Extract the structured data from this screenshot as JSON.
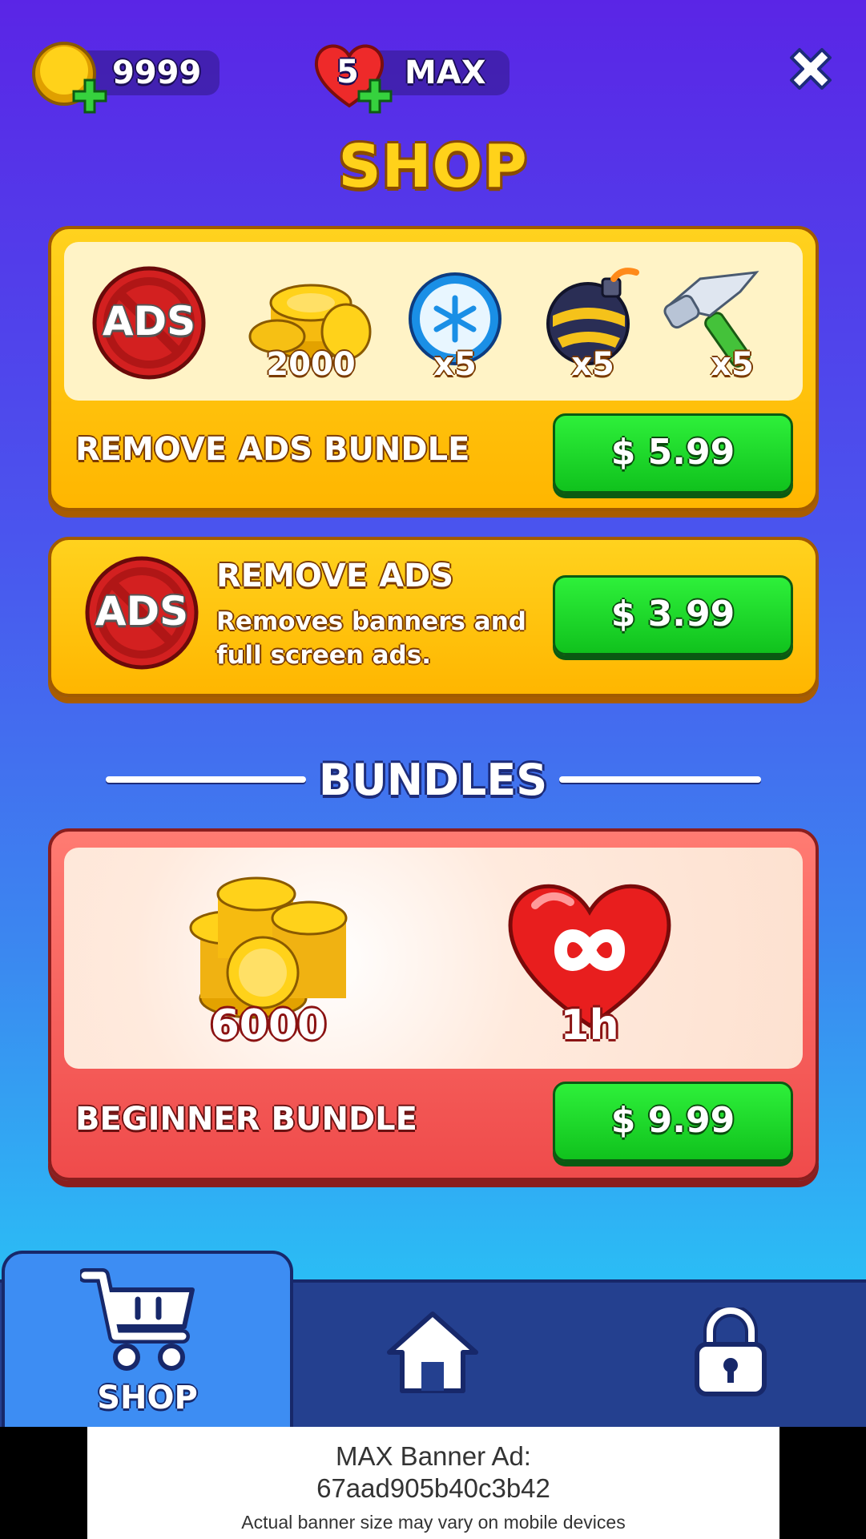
{
  "header": {
    "coins": "9999",
    "lives_count": "5",
    "lives_status": "MAX",
    "title": "SHOP"
  },
  "remove_ads_bundle": {
    "ads_badge": "ADS",
    "items": [
      {
        "name": "coins",
        "qty": "2000"
      },
      {
        "name": "freeze",
        "qty": "x5"
      },
      {
        "name": "bomb",
        "qty": "x5"
      },
      {
        "name": "hammer",
        "qty": "x5"
      }
    ],
    "label": "REMOVE ADS BUNDLE",
    "price": "$ 5.99"
  },
  "remove_ads": {
    "ads_badge": "ADS",
    "title": "REMOVE ADS",
    "desc_line1": "Removes banners and",
    "desc_line2": "full screen ads.",
    "price": "$ 3.99"
  },
  "bundles_heading": "BUNDLES",
  "beginner_bundle": {
    "coins_qty": "6000",
    "lives_qty": "1h",
    "label": "BEGINNER BUNDLE",
    "price": "$ 9.99"
  },
  "nav": {
    "shop_label": "SHOP",
    "icons": [
      "cart-icon",
      "home-icon",
      "lock-icon"
    ]
  },
  "banner": {
    "line1": "MAX Banner Ad:",
    "line2": "67aad905b40c3b42",
    "line3": "Actual banner size may vary on mobile devices"
  },
  "colors": {
    "button_green": "#14c81f",
    "card_yellow": "#ffc30d",
    "card_red": "#f25a55",
    "title_yellow": "#ffd21a"
  }
}
